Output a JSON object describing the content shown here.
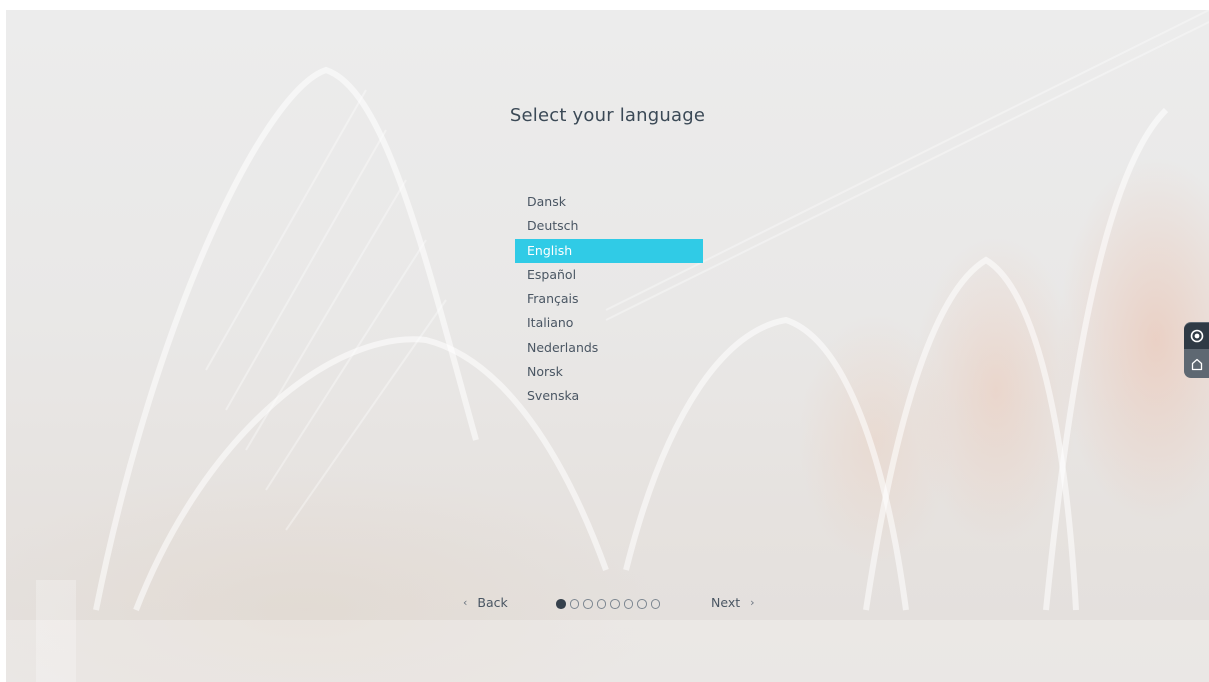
{
  "setup": {
    "title": "Select your language",
    "languages": [
      {
        "label": "Dansk",
        "selected": false
      },
      {
        "label": "Deutsch",
        "selected": false
      },
      {
        "label": "English",
        "selected": true
      },
      {
        "label": "Español",
        "selected": false
      },
      {
        "label": "Français",
        "selected": false
      },
      {
        "label": "Italiano",
        "selected": false
      },
      {
        "label": "Nederlands",
        "selected": false
      },
      {
        "label": "Norsk",
        "selected": false
      },
      {
        "label": "Svenska",
        "selected": false
      }
    ],
    "nav": {
      "back_label": "Back",
      "next_label": "Next",
      "back_icon": "chevron-left-icon",
      "next_icon": "chevron-right-icon"
    },
    "progress": {
      "total_steps": 8,
      "current_step": 1
    }
  },
  "side_toolbar": {
    "items": [
      {
        "icon": "record-icon"
      },
      {
        "icon": "home-icon"
      }
    ]
  },
  "colors": {
    "accent": "#30cbe6",
    "text": "#3b4956",
    "toolbar_dark": "#2f3a45",
    "toolbar": "#5e6872"
  }
}
